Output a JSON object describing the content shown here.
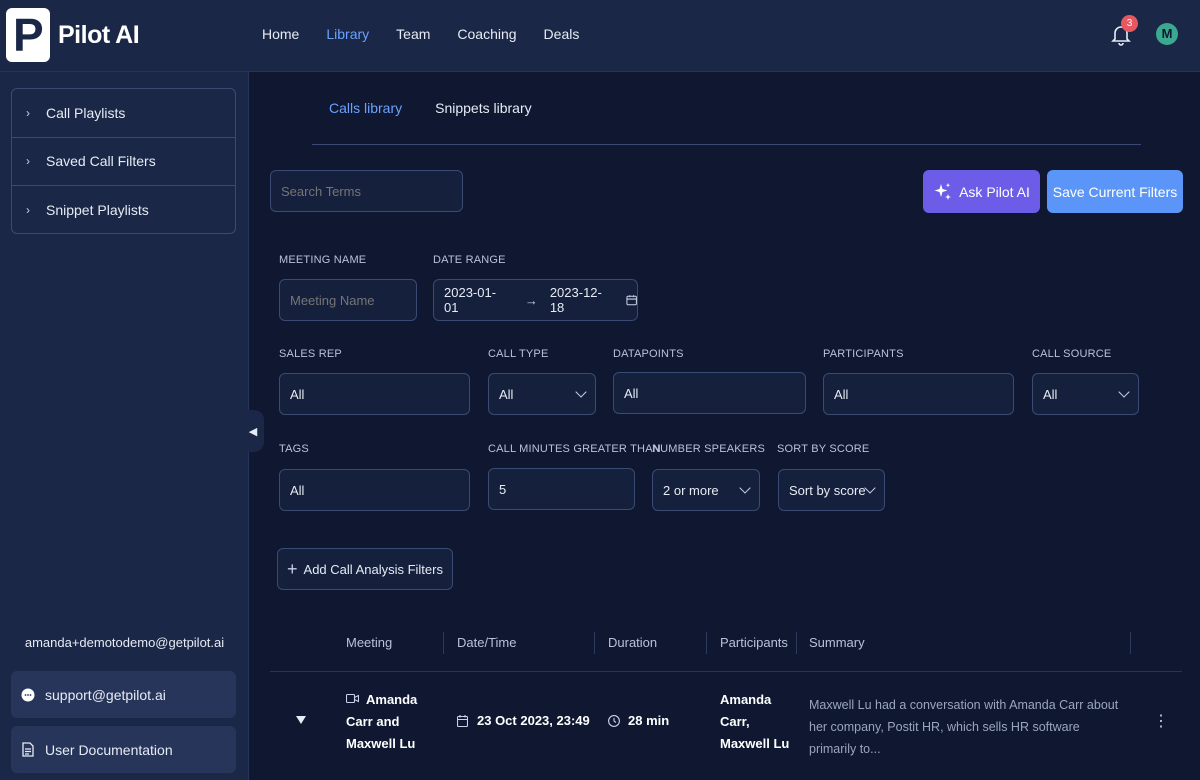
{
  "brand": {
    "name": "Pilot AI",
    "logo_letter": "P"
  },
  "nav": [
    {
      "label": "Home",
      "active": false
    },
    {
      "label": "Library",
      "active": true
    },
    {
      "label": "Team",
      "active": false
    },
    {
      "label": "Coaching",
      "active": false
    },
    {
      "label": "Deals",
      "active": false
    }
  ],
  "notifications": {
    "count": "3"
  },
  "user": {
    "initial": "M",
    "email": "amanda+demotodemo@getpilot.ai"
  },
  "sidebar": {
    "items": [
      "Call Playlists",
      "Saved Call Filters",
      "Snippet Playlists"
    ],
    "support": "support@getpilot.ai",
    "docs": "User Documentation"
  },
  "tabs": [
    {
      "label": "Calls library",
      "active": true
    },
    {
      "label": "Snippets library",
      "active": false
    }
  ],
  "search": {
    "placeholder": "Search Terms"
  },
  "actions": {
    "ask": "Ask Pilot AI",
    "save": "Save Current Filters",
    "add": "Add Call Analysis Filters"
  },
  "filters": {
    "meeting_name": {
      "label": "MEETING NAME",
      "placeholder": "Meeting Name"
    },
    "date_range": {
      "label": "DATE RANGE",
      "start": "2023-01-01",
      "end": "2023-12-18",
      "arrow": "→"
    },
    "sales_rep": {
      "label": "SALES REP",
      "value": "All"
    },
    "call_type": {
      "label": "CALL TYPE",
      "value": "All"
    },
    "datapoints": {
      "label": "DATAPOINTS",
      "value": "All"
    },
    "participants": {
      "label": "PARTICIPANTS",
      "value": "All"
    },
    "call_source": {
      "label": "CALL SOURCE",
      "value": "All"
    },
    "tags": {
      "label": "TAGS",
      "value": "All"
    },
    "call_minutes": {
      "label": "CALL MINUTES GREATER THAN",
      "value": "5"
    },
    "speakers": {
      "label": "NUMBER SPEAKERS",
      "value": "2 or more"
    },
    "sort": {
      "label": "SORT BY SCORE",
      "value": "Sort by score"
    }
  },
  "table": {
    "headers": [
      "Meeting",
      "Date/Time",
      "Duration",
      "Participants",
      "Summary"
    ],
    "rows": [
      {
        "meeting_lines": [
          "Amanda",
          "Carr and",
          "Maxwell Lu"
        ],
        "datetime": "23 Oct 2023, 23:49",
        "duration": "28 min",
        "participant_lines": [
          "Amanda",
          "Carr,",
          "Maxwell Lu"
        ],
        "summary": "Maxwell Lu had a conversation with Amanda Carr about her company, Postit HR, which sells HR software primarily to..."
      }
    ]
  },
  "colors": {
    "accent": "#6aa1ff",
    "ask_button": "#6c5ce7",
    "save_button": "#5b95f8",
    "badge": "#e8575f",
    "avatar": "#3aa98f"
  }
}
